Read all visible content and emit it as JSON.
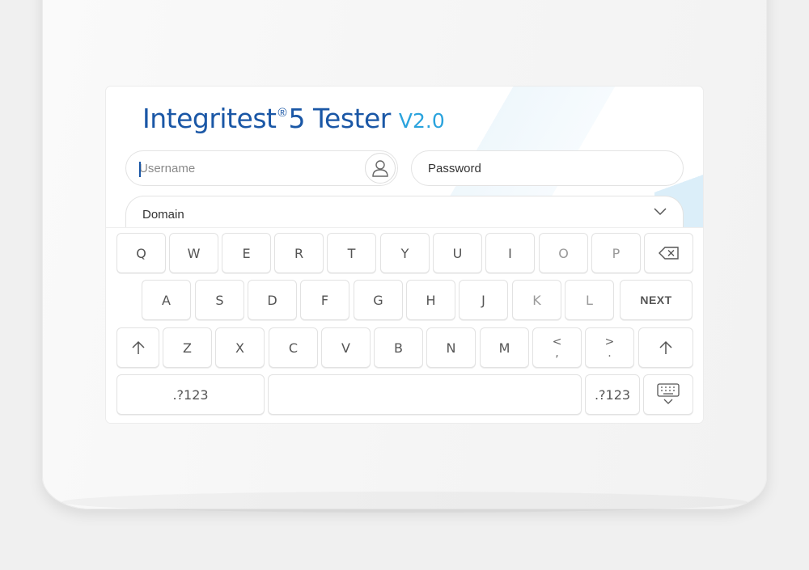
{
  "app": {
    "brand": "Integritest",
    "registered": "®",
    "model": "5 Tester",
    "version": "V2.0"
  },
  "login": {
    "username_placeholder": "Username",
    "password_placeholder": "Password",
    "domain_label": "Domain"
  },
  "keyboard": {
    "row1": [
      "Q",
      "W",
      "E",
      "R",
      "T",
      "Y",
      "U",
      "I",
      "O",
      "P"
    ],
    "row2": [
      "A",
      "S",
      "D",
      "F",
      "G",
      "H",
      "J",
      "K",
      "L"
    ],
    "next_label": "NEXT",
    "row3": [
      "Z",
      "X",
      "C",
      "V",
      "B",
      "N",
      "M"
    ],
    "comma_key": {
      "top": "<",
      "bottom": ","
    },
    "period_key": {
      "top": ">",
      "bottom": "."
    },
    "symbols_left": ".?123",
    "symbols_right": ".?123",
    "icons": {
      "backspace": "backspace-icon",
      "shift": "shift-up-arrow-icon",
      "hide_keyboard": "keyboard-hide-icon"
    }
  },
  "colors": {
    "brand_blue": "#1a57a6",
    "version_blue": "#2aa3dd"
  }
}
